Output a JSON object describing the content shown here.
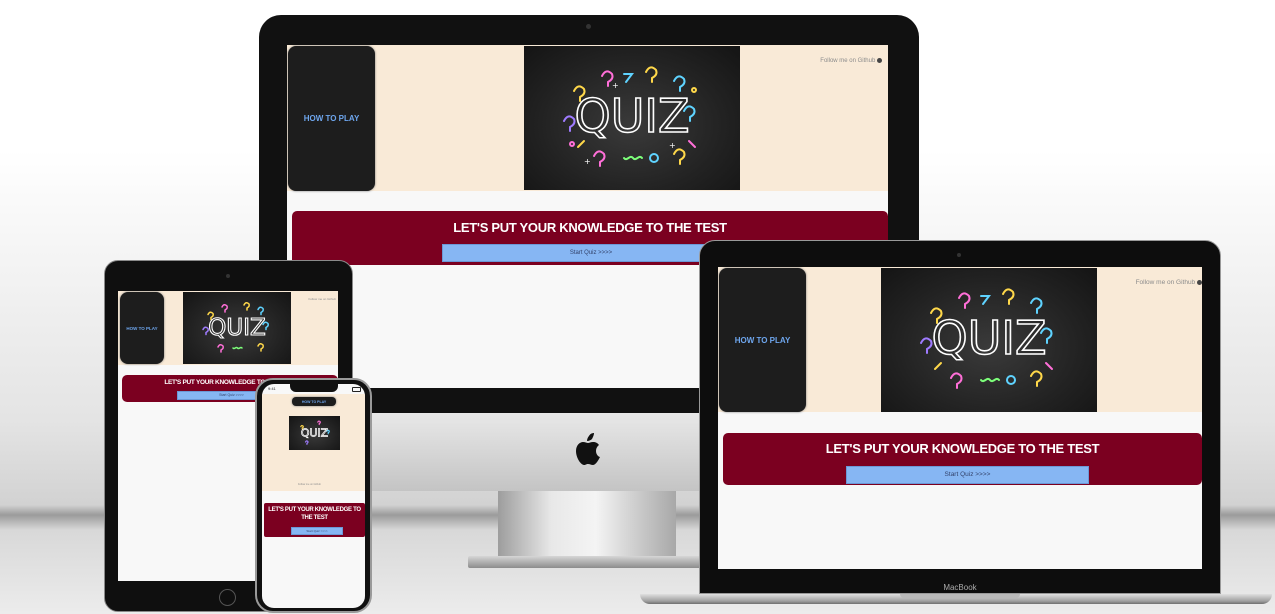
{
  "site": {
    "how_to_play": "HOW TO PLAY",
    "quiz_image_text": "QUIZ",
    "follow": "Follow me on Github",
    "banner_title": "LET'S PUT YOUR KNOWLEDGE TO THE TEST",
    "banner_title_mobile": "LET'S PUT YOUR KNOWLEDGE TO THE TEST",
    "start_button": "Start Quiz >>>>"
  },
  "devices": {
    "laptop_label": "MacBook",
    "phone_time": "9:41"
  },
  "colors": {
    "header_bg": "#f9ead7",
    "nav_bg": "#1d1d1d",
    "nav_text": "#6ea6ee",
    "banner_bg": "#7b0020",
    "button_bg": "#86b6f3"
  }
}
